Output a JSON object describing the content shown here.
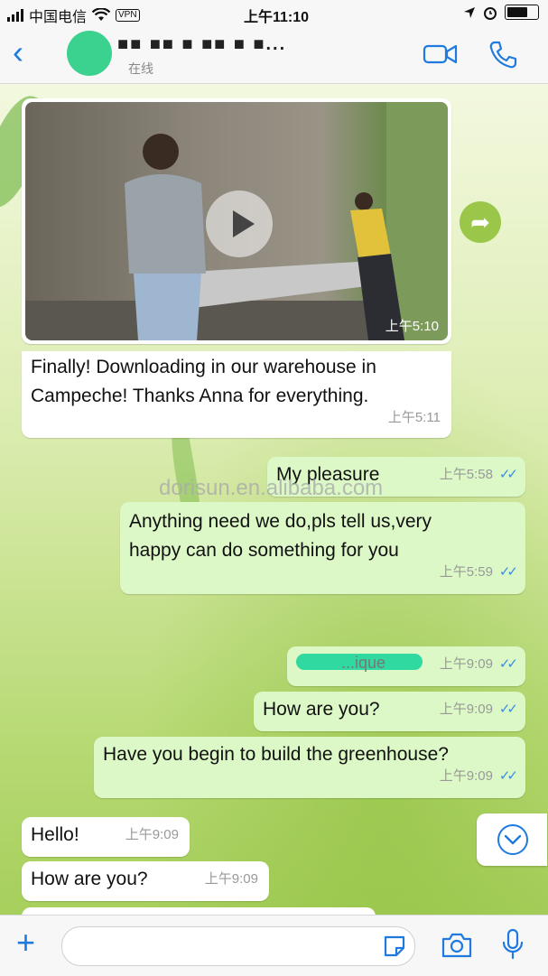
{
  "status_bar": {
    "carrier": "中国电信",
    "vpn": "VPN",
    "time": "上午11:10"
  },
  "header": {
    "contact_name": "■■ ■■ ■ ■■ ■ ■...",
    "presence": "在线"
  },
  "messages": {
    "video": {
      "time": "上午5:10"
    },
    "m1": {
      "text_line1": "Finally! Downloading in our warehouse in",
      "text_line2": "Campeche! Thanks Anna for everything.",
      "time": "上午5:11"
    },
    "m2": {
      "text": "My pleasure",
      "time": "上午5:58"
    },
    "m3": {
      "text_line1": "Anything need we do,pls tell us,very",
      "text_line2": "happy can do something for you",
      "time": "上午5:59"
    },
    "m4": {
      "text": "...ique",
      "time": "上午9:09"
    },
    "m5": {
      "text": "How are you?",
      "time": "上午9:09"
    },
    "m6": {
      "text": "Have you begin to build the greenhouse?",
      "time": "上午9:09"
    },
    "m7": {
      "text": "Hello!",
      "time": "上午9:09"
    },
    "m8": {
      "text": "How are you?",
      "time": "上午9:09"
    }
  },
  "watermark": "dorisun.en.alibaba.com",
  "colors": {
    "accent": "#1f7ae0",
    "outgoing_bubble": "#dcf8c6",
    "incoming_bubble": "#ffffff",
    "read_ticks": "#3b8de0"
  }
}
